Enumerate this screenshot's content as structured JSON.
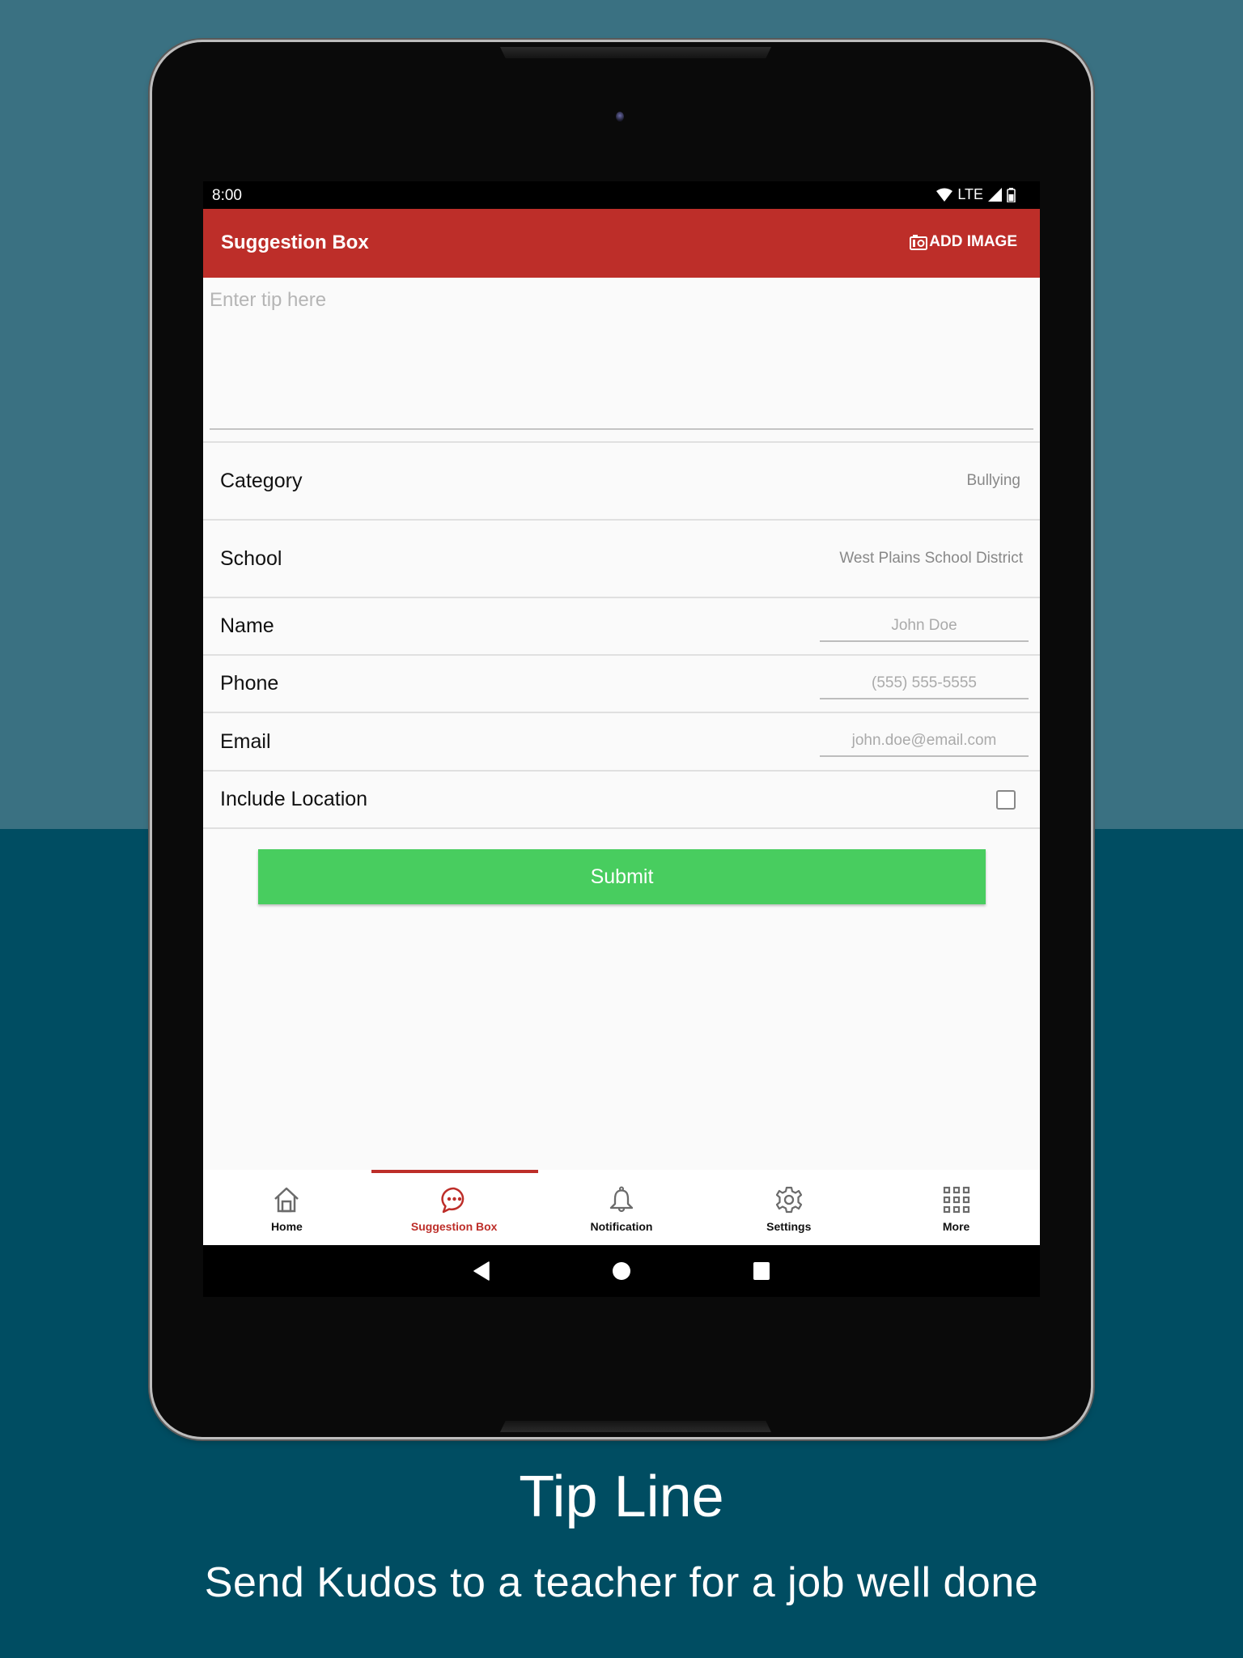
{
  "status_bar": {
    "time": "8:00",
    "network": "LTE",
    "icons": [
      "wifi-icon",
      "cell-signal-icon",
      "battery-icon"
    ]
  },
  "app_bar": {
    "title": "Suggestion Box",
    "add_image_label": "ADD IMAGE",
    "add_image_icon": "camera-icon"
  },
  "form": {
    "tip_placeholder": "Enter tip here",
    "tip_value": "",
    "category": {
      "label": "Category",
      "value": "Bullying"
    },
    "school": {
      "label": "School",
      "value": "West Plains School District"
    },
    "name": {
      "label": "Name",
      "placeholder": "John Doe",
      "value": ""
    },
    "phone": {
      "label": "Phone",
      "placeholder": "(555) 555-5555",
      "value": ""
    },
    "email": {
      "label": "Email",
      "placeholder": "john.doe@email.com",
      "value": ""
    },
    "include_location": {
      "label": "Include Location",
      "checked": false
    },
    "submit_label": "Submit"
  },
  "bottom_nav": {
    "active": "Suggestion Box",
    "items": [
      {
        "label": "Home",
        "icon": "home-icon"
      },
      {
        "label": "Suggestion Box",
        "icon": "chat-bubble-icon"
      },
      {
        "label": "Notification",
        "icon": "bell-icon"
      },
      {
        "label": "Settings",
        "icon": "gear-icon"
      },
      {
        "label": "More",
        "icon": "grid-icon"
      }
    ]
  },
  "system_nav": [
    "back-icon",
    "home-circle-icon",
    "recents-icon"
  ],
  "colors": {
    "accent_red": "#bd2e29",
    "submit_green": "#48cd5f",
    "bg_top": "#3a7182",
    "bg_bottom": "#004d62"
  },
  "promo": {
    "title": "Tip Line",
    "subtitle": "Send Kudos to a teacher for a job well done"
  }
}
